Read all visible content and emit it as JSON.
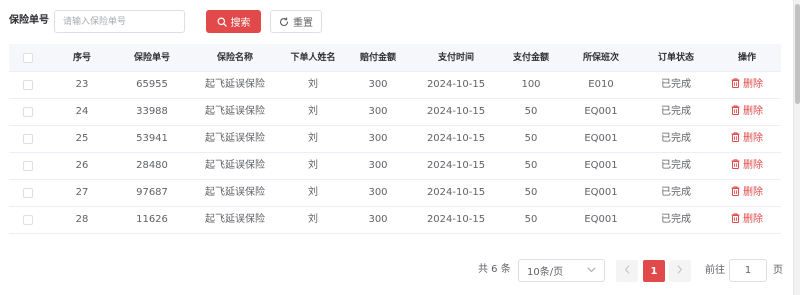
{
  "search": {
    "label": "保险单号",
    "placeholder": "请输入保险单号",
    "value": "",
    "search_button": "搜索",
    "reset_button": "重置"
  },
  "table": {
    "columns": [
      "序号",
      "保险单号",
      "保险名称",
      "下单人姓名",
      "赔付金额",
      "支付时间",
      "支付金额",
      "所保班次",
      "订单状态",
      "操作"
    ],
    "rows": [
      {
        "idx": "23",
        "no": "65955",
        "name": "起飞延误保险",
        "user": "刘",
        "claim": "300",
        "time": "2024-10-15",
        "pay": "100",
        "flight": "E010",
        "status": "已完成",
        "action": "删除"
      },
      {
        "idx": "24",
        "no": "33988",
        "name": "起飞延误保险",
        "user": "刘",
        "claim": "300",
        "time": "2024-10-15",
        "pay": "50",
        "flight": "EQ001",
        "status": "已完成",
        "action": "删除"
      },
      {
        "idx": "25",
        "no": "53941",
        "name": "起飞延误保险",
        "user": "刘",
        "claim": "300",
        "time": "2024-10-15",
        "pay": "50",
        "flight": "EQ001",
        "status": "已完成",
        "action": "删除"
      },
      {
        "idx": "26",
        "no": "28480",
        "name": "起飞延误保险",
        "user": "刘",
        "claim": "300",
        "time": "2024-10-15",
        "pay": "50",
        "flight": "EQ001",
        "status": "已完成",
        "action": "删除"
      },
      {
        "idx": "27",
        "no": "97687",
        "name": "起飞延误保险",
        "user": "刘",
        "claim": "300",
        "time": "2024-10-15",
        "pay": "50",
        "flight": "EQ001",
        "status": "已完成",
        "action": "删除"
      },
      {
        "idx": "28",
        "no": "11626",
        "name": "起飞延误保险",
        "user": "刘",
        "claim": "300",
        "time": "2024-10-15",
        "pay": "50",
        "flight": "EQ001",
        "status": "已完成",
        "action": "删除"
      }
    ]
  },
  "pagination": {
    "total": "共 6 条",
    "page_size": "10条/页",
    "current_page": "1",
    "goto_label": "前往",
    "goto_value": "1",
    "page_unit": "页"
  },
  "colors": {
    "accent": "#e1494a",
    "header_bg": "#f5f7fa",
    "border": "#ebeef5"
  },
  "icons": {
    "search_button": "search-icon",
    "reset_button": "refresh-icon",
    "delete_action": "trash-icon",
    "page_size": "chevron-down-icon",
    "prev": "chevron-left-icon",
    "next": "chevron-right-icon"
  }
}
